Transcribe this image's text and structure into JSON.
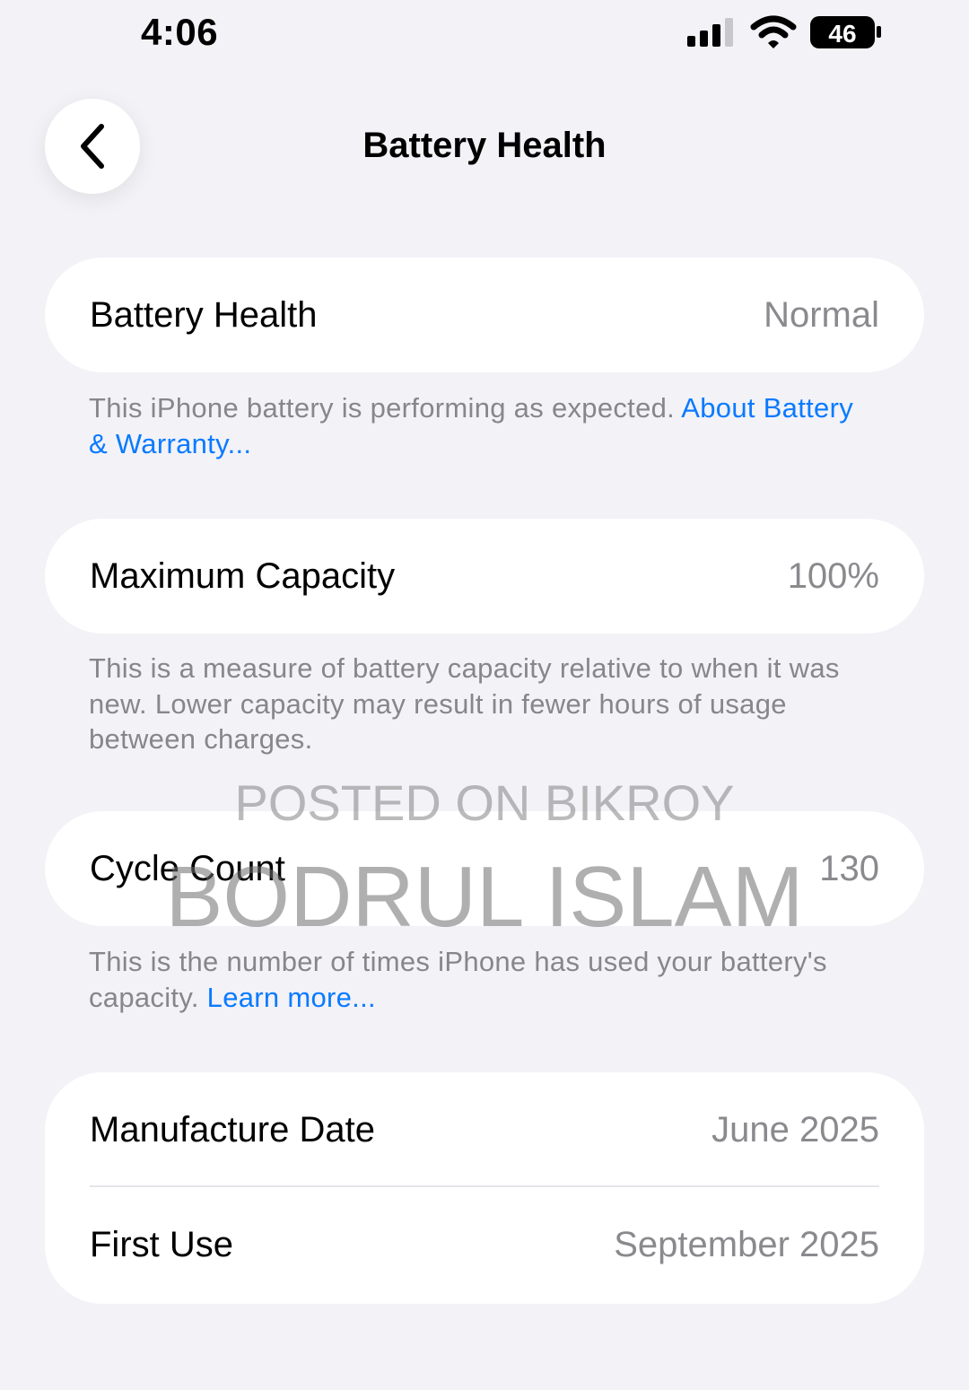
{
  "status_bar": {
    "time": "4:06",
    "battery_level": "46",
    "signal_bars": 3
  },
  "nav": {
    "title": "Battery Health"
  },
  "health": {
    "label": "Battery Health",
    "value": "Normal"
  },
  "health_note": {
    "text": "This iPhone battery is performing as expected. ",
    "link": "About Battery & Warranty..."
  },
  "capacity": {
    "label": "Maximum Capacity",
    "value": "100%"
  },
  "capacity_note": {
    "text": "This is a measure of battery capacity relative to when it was new. Lower capacity may result in fewer hours of usage between charges."
  },
  "cycle": {
    "label": "Cycle Count",
    "value": "130"
  },
  "cycle_note": {
    "text": "This is the number of times iPhone has used your battery's capacity. ",
    "link": "Learn more..."
  },
  "dates": [
    {
      "label": "Manufacture Date",
      "value": "June 2025"
    },
    {
      "label": "First Use",
      "value": "September 2025"
    }
  ],
  "watermark": {
    "line1": "POSTED ON BIKROY",
    "line2": "BODRUL ISLAM"
  }
}
